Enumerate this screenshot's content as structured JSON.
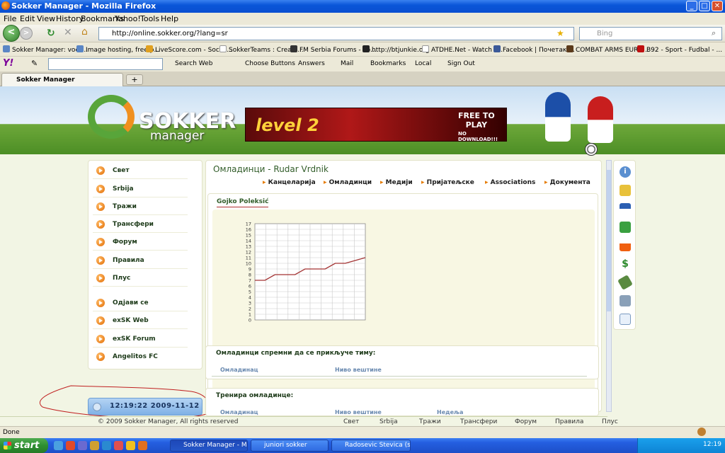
{
  "window": {
    "title": "Sokker Manager - Mozilla Firefox",
    "min": "_",
    "max": "□",
    "close": "✕"
  },
  "menu": [
    "File",
    "Edit",
    "View",
    "History",
    "Bookmarks",
    "Yahoo!",
    "Tools",
    "Help"
  ],
  "nav": {
    "back": "<",
    "forward": ">",
    "url": "http://online.sokker.org/?lang=sr",
    "search_placeholder": "Bing"
  },
  "bookmarks": [
    "Sokker Manager: voet...",
    "Image hosting, free p...",
    "LiveScore.com - Socce...",
    "SokkerTeams : Crea u...",
    "FM Serbia Forums - Po...",
    "http://btjunkie.org",
    "ATDHE.Net - Watch F...",
    "Facebook | Почетак ...",
    "COMBAT ARMS EURO...",
    "B92 - Sport - Fudbal - ..."
  ],
  "yahoo_bar": {
    "logo": "Y!",
    "items": [
      "Search Web",
      "Choose Buttons",
      "Answers",
      "Mail",
      "Bookmarks",
      "Local",
      "Sign Out"
    ]
  },
  "tab": {
    "label": "Sokker Manager",
    "new_tab": "+"
  },
  "banner": {
    "logo_line1": "SOKKER",
    "logo_line2": "manager",
    "ad_level": "level 2",
    "ad_free": "FREE TO\nPLAY",
    "ad_nodownload": "NO DOWNLOAD!!!"
  },
  "left_menu": [
    "Свет",
    "Srbija",
    "Тражи",
    "Трансфери",
    "Форум",
    "Правила",
    "Плус",
    "Одјави се",
    "exSK Web",
    "exSK Forum",
    "Angelitos FC"
  ],
  "clock": "12:19:22  2009-11-12",
  "main": {
    "title": "Омладинци - Rudar Vrdnik",
    "subnav": [
      "Канцеларија",
      "Омладинци",
      "Медији",
      "Пријатељске",
      "Associations",
      "Документа"
    ],
    "player_name": "Gojko Poleksić"
  },
  "chart_data": {
    "type": "line",
    "title": "",
    "xlabel": "",
    "ylabel": "",
    "ylim": [
      0,
      17
    ],
    "y_ticks": [
      "17",
      "16",
      "15",
      "14",
      "13",
      "12",
      "11",
      "10",
      "9",
      "8",
      "7",
      "6",
      "5",
      "4",
      "3",
      "2",
      "1",
      "0"
    ],
    "x": [
      0,
      1,
      2,
      3,
      4,
      5,
      6,
      7,
      8,
      9,
      10
    ],
    "values": [
      7,
      7,
      8,
      8,
      8,
      9,
      9,
      9,
      10,
      10,
      10.5,
      11
    ],
    "series_color": "#a33333",
    "grid": true
  },
  "box_ready": {
    "title": "Омладинци спремни да се прикључе тиму:",
    "col1": "Омладинац",
    "col2": "Ниво вештине"
  },
  "box_training": {
    "title": "Тренира омладинце:",
    "col1": "Омладинац",
    "col2": "Ниво вештине",
    "col3": "Недеља"
  },
  "footer": {
    "copyright": "© 2009 Sokker Manager, All rights reserved",
    "links": [
      "Свет",
      "Srbija",
      "Тражи",
      "Трансфери",
      "Форум",
      "Правила",
      "Плус"
    ]
  },
  "status": "Done",
  "taskbar": {
    "start": "start",
    "items": [
      "Sokker Manager - Mo...",
      "juniori sokker",
      "Radosevic Stevica (st..."
    ],
    "time": "12:19"
  },
  "colors": {
    "accent_green": "#325d2a",
    "menu_orange": "#e26a00",
    "chart_line": "#a33333"
  }
}
